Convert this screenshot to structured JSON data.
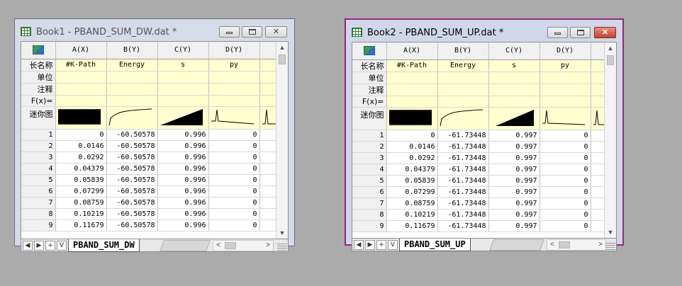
{
  "windows": [
    {
      "title": "Book1 - PBAND_SUM_DW.dat *",
      "sheet_tab": "PBAND_SUM_DW",
      "columns": [
        "A(X)",
        "B(Y)",
        "C(Y)",
        "D(Y)"
      ],
      "meta_rows": [
        {
          "label": "长名称",
          "values": [
            "#K-Path",
            "Energy",
            "s",
            "py"
          ]
        },
        {
          "label": "单位",
          "values": [
            "",
            "",
            "",
            ""
          ]
        },
        {
          "label": "注释",
          "values": [
            "",
            "",
            "",
            ""
          ]
        },
        {
          "label": "F(x)=",
          "values": [
            "",
            "",
            "",
            ""
          ]
        }
      ],
      "sparkline_label": "迷你图",
      "rows": [
        {
          "n": "1",
          "cells": [
            "0",
            "-60.50578",
            "0.996",
            "0"
          ]
        },
        {
          "n": "2",
          "cells": [
            "0.0146",
            "-60.50578",
            "0.996",
            "0"
          ]
        },
        {
          "n": "3",
          "cells": [
            "0.0292",
            "-60.50578",
            "0.996",
            "0"
          ]
        },
        {
          "n": "4",
          "cells": [
            "0.04379",
            "-60.50578",
            "0.996",
            "0"
          ]
        },
        {
          "n": "5",
          "cells": [
            "0.05839",
            "-60.50578",
            "0.996",
            "0"
          ]
        },
        {
          "n": "6",
          "cells": [
            "0.07299",
            "-60.50578",
            "0.996",
            "0"
          ]
        },
        {
          "n": "7",
          "cells": [
            "0.08759",
            "-60.50578",
            "0.996",
            "0"
          ]
        },
        {
          "n": "8",
          "cells": [
            "0.10219",
            "-60.50578",
            "0.996",
            "0"
          ]
        },
        {
          "n": "9",
          "cells": [
            "0.11679",
            "-60.50578",
            "0.996",
            "0"
          ]
        }
      ]
    },
    {
      "title": "Book2 - PBAND_SUM_UP.dat *",
      "sheet_tab": "PBAND_SUM_UP",
      "columns": [
        "A(X)",
        "B(Y)",
        "C(Y)",
        "D(Y)"
      ],
      "meta_rows": [
        {
          "label": "长名称",
          "values": [
            "#K-Path",
            "Energy",
            "s",
            "py"
          ]
        },
        {
          "label": "单位",
          "values": [
            "",
            "",
            "",
            ""
          ]
        },
        {
          "label": "注释",
          "values": [
            "",
            "",
            "",
            ""
          ]
        },
        {
          "label": "F(x)=",
          "values": [
            "",
            "",
            "",
            ""
          ]
        }
      ],
      "sparkline_label": "迷你图",
      "rows": [
        {
          "n": "1",
          "cells": [
            "0",
            "-61.73448",
            "0.997",
            "0"
          ]
        },
        {
          "n": "2",
          "cells": [
            "0.0146",
            "-61.73448",
            "0.997",
            "0"
          ]
        },
        {
          "n": "3",
          "cells": [
            "0.0292",
            "-61.73448",
            "0.997",
            "0"
          ]
        },
        {
          "n": "4",
          "cells": [
            "0.04379",
            "-61.73448",
            "0.997",
            "0"
          ]
        },
        {
          "n": "5",
          "cells": [
            "0.05839",
            "-61.73448",
            "0.997",
            "0"
          ]
        },
        {
          "n": "6",
          "cells": [
            "0.07299",
            "-61.73448",
            "0.997",
            "0"
          ]
        },
        {
          "n": "7",
          "cells": [
            "0.08759",
            "-61.73448",
            "0.997",
            "0"
          ]
        },
        {
          "n": "8",
          "cells": [
            "0.10219",
            "-61.73448",
            "0.997",
            "0"
          ]
        },
        {
          "n": "9",
          "cells": [
            "0.11679",
            "-61.73448",
            "0.997",
            "0"
          ]
        }
      ]
    }
  ],
  "nav_buttons": {
    "first": "◀",
    "prev": "▶",
    "add": "+",
    "menu": "V"
  },
  "colors": {
    "active_border": "#a0207e",
    "meta_bg": "#ffffd0",
    "desktop": "#ababab"
  }
}
